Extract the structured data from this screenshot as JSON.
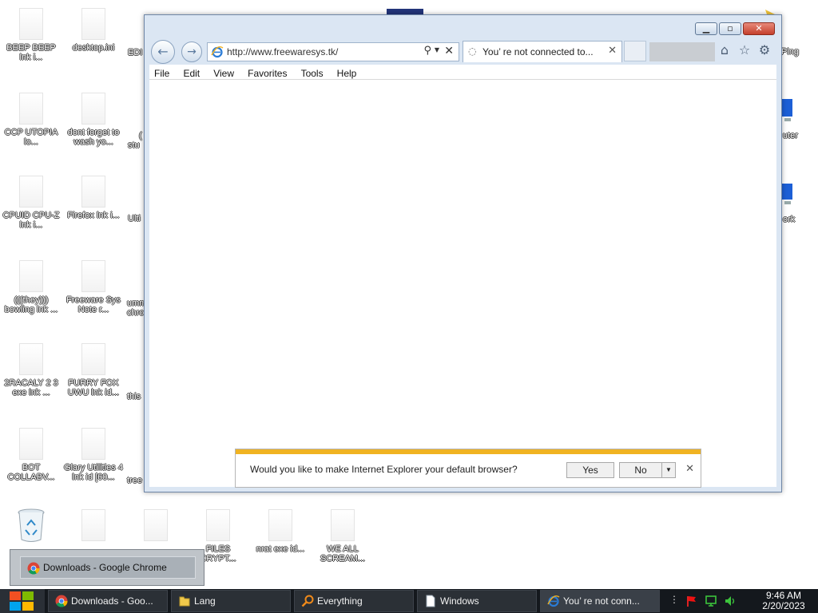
{
  "desktop": {
    "icons": [
      {
        "label": "BEEP BEEP lnk i..."
      },
      {
        "label": "desktop.ini"
      },
      {
        "label": "CCP UTOPIA lo..."
      },
      {
        "label": "dont forget to wash yo..."
      },
      {
        "label": "CPUID CPU-Z lnk i..."
      },
      {
        "label": "Firefox lnk i..."
      },
      {
        "label": "(((they))) bowling lnk ..."
      },
      {
        "label": "Freeware Sys Note r..."
      },
      {
        "label": "2RACALY 2 3 exe lnk ..."
      },
      {
        "label": "FURRY FOX UWU lnk id..."
      },
      {
        "label": "BOT COLLABV..."
      },
      {
        "label": "Glary Utilities 4 lnk id [60..."
      },
      {
        "label": "FILES CRYPT..."
      },
      {
        "label": "nrat exe id..."
      },
      {
        "label": "WE ALL SCREAM..."
      }
    ],
    "partial_labels": [
      "EDI",
      "(",
      "stu",
      "Ulti",
      "umm",
      "chro",
      "this",
      "tree",
      "Ping",
      "uter",
      "ork"
    ]
  },
  "browser": {
    "url": "http://www.freewaresys.tk/",
    "tab_title": "You’ re not connected to...",
    "menu": [
      "File",
      "Edit",
      "View",
      "Favorites",
      "Tools",
      "Help"
    ],
    "notification": {
      "message": "Would you like to make Internet Explorer your default browser?",
      "yes_label": "Yes",
      "no_label": "No"
    }
  },
  "thumbnail_popup": {
    "label": "Downloads - Google Chrome"
  },
  "taskbar": {
    "items": [
      {
        "label": "Downloads - Goo...",
        "icon": "chrome-icon"
      },
      {
        "label": "Lang",
        "icon": "folder-icon"
      },
      {
        "label": "Everything",
        "icon": "search-icon"
      },
      {
        "label": "Windows",
        "icon": "document-icon"
      },
      {
        "label": "You’ re not conn...",
        "icon": "ie-icon"
      }
    ],
    "time": "9:46 AM",
    "date": "2/20/2023"
  },
  "colors": {
    "notification_stripe": "#f0b322",
    "taskbar": "#14181d",
    "window_frame": "#dbe6f3",
    "close_button": "#c4402c"
  }
}
